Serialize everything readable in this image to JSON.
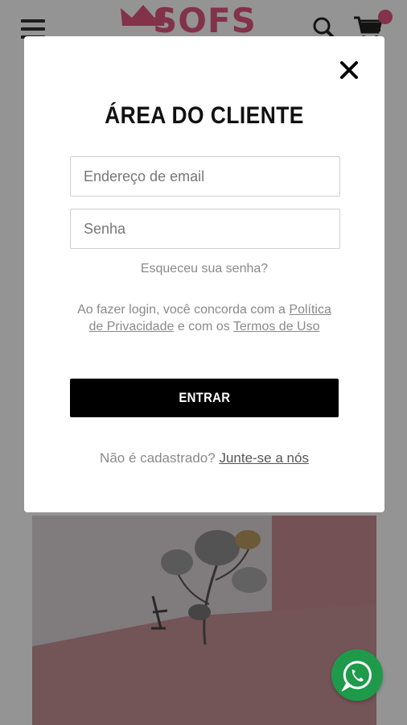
{
  "header": {
    "logo_text": "SOFS"
  },
  "modal": {
    "title": "ÁREA DO CLIENTE",
    "email_placeholder": "Endereço de email",
    "password_placeholder": "Senha",
    "forgot_password": "Esqueceu sua senha?",
    "terms_prefix": "Ao fazer login, você concorda com a",
    "privacy_link": "Política de Privacidade",
    "terms_middle": "e com os",
    "terms_link": "Termos de Uso",
    "submit_label": "ENTRAR",
    "register_prompt": "Não é cadastrado?",
    "register_link": "Junte-se a nós"
  },
  "colors": {
    "brand_pink": "#e0567e",
    "button_black": "#000000",
    "whatsapp_green": "#1e9a4a"
  },
  "icons": {
    "menu": "hamburger-menu-icon",
    "search": "search-icon",
    "cart": "shopping-cart-icon",
    "close": "close-icon",
    "whatsapp": "whatsapp-icon"
  }
}
